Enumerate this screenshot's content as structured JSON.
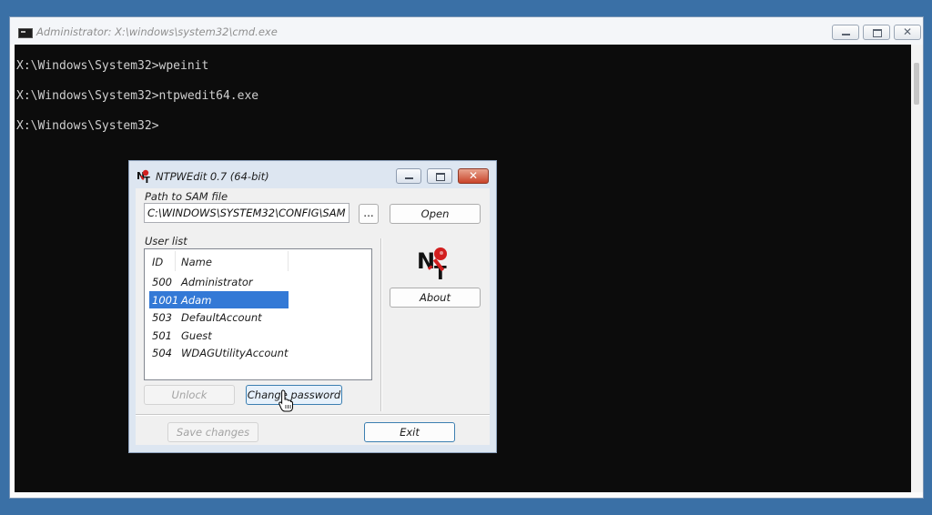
{
  "cmd": {
    "title": "Administrator: X:\\windows\\system32\\cmd.exe",
    "lines": [
      "X:\\Windows\\System32>wpeinit",
      "X:\\Windows\\System32>ntpwedit64.exe",
      "X:\\Windows\\System32>"
    ],
    "close_glyph": "✕"
  },
  "dialog": {
    "title": "NTPWEdit 0.7 (64-bit)",
    "close_glyph": "✕",
    "path_label": "Path to SAM file",
    "path_value": "C:\\WINDOWS\\SYSTEM32\\CONFIG\\SAM",
    "browse_label": "...",
    "open_label": "Open",
    "user_list_label": "User list",
    "columns": [
      "ID",
      "Name"
    ],
    "users": [
      {
        "id": "500",
        "name": "Administrator"
      },
      {
        "id": "1001",
        "name": "Adam"
      },
      {
        "id": "503",
        "name": "DefaultAccount"
      },
      {
        "id": "501",
        "name": "Guest"
      },
      {
        "id": "504",
        "name": "WDAGUtilityAccount"
      }
    ],
    "selected_user_index": 1,
    "about_label": "About",
    "unlock_label": "Unlock",
    "change_password_label": "Change password",
    "save_label": "Save changes",
    "exit_label": "Exit"
  },
  "colors": {
    "desktop": "#3a70a6",
    "console_bg": "#0c0c0c",
    "selection": "#3379d6",
    "logo_red": "#d21f1f"
  }
}
